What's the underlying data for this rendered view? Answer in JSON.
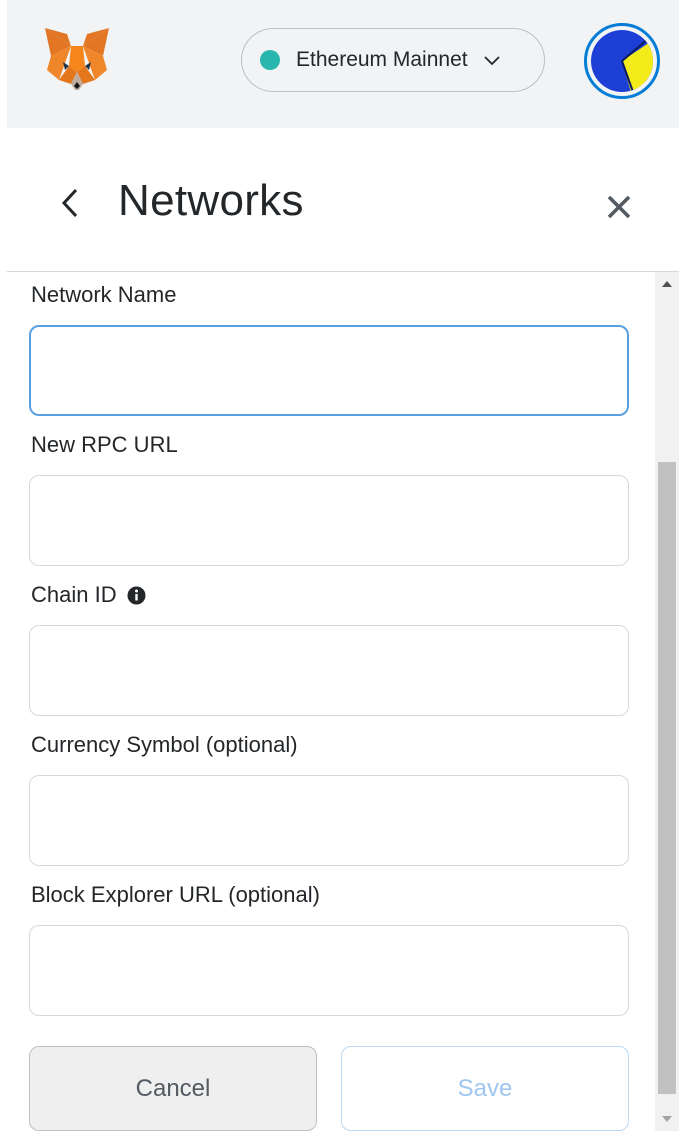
{
  "header": {
    "network_label": "Ethereum Mainnet",
    "network_status_color": "#29b6af",
    "logo_icon": "metamask-fox-icon",
    "account_icon": "account-avatar"
  },
  "subheader": {
    "title": "Networks",
    "back_icon": "chevron-left-icon",
    "close_icon": "close-icon"
  },
  "form": {
    "network_name": {
      "label": "Network Name",
      "value": ""
    },
    "rpc_url": {
      "label": "New RPC URL",
      "value": ""
    },
    "chain_id": {
      "label": "Chain ID",
      "value": "",
      "info_icon": "info-icon"
    },
    "currency_symbol": {
      "label": "Currency Symbol (optional)",
      "value": ""
    },
    "block_explorer": {
      "label": "Block Explorer URL (optional)",
      "value": ""
    }
  },
  "actions": {
    "cancel_label": "Cancel",
    "save_label": "Save"
  },
  "colors": {
    "accent": "#037dd6",
    "focus_border": "#5c9fe0",
    "save_disabled_text": "#9fc6ef"
  }
}
